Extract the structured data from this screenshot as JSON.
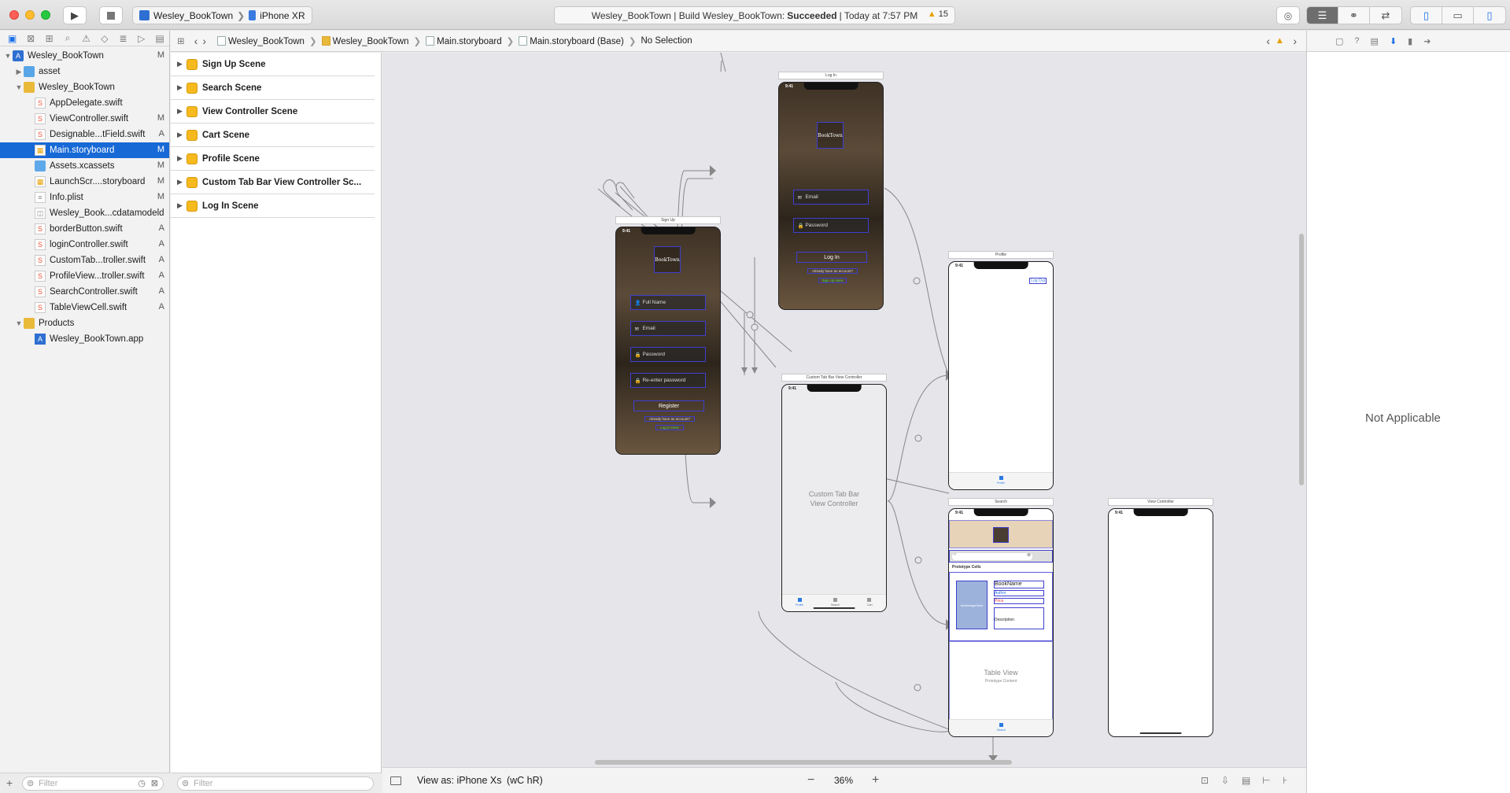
{
  "toolbar": {
    "scheme_target": "Wesley_BookTown",
    "scheme_device": "iPhone XR",
    "status_prefix": "Wesley_BookTown | Build Wesley_BookTown:",
    "status_result": "Succeeded",
    "status_time": "| Today at 7:57 PM",
    "warning_count": "15"
  },
  "navigator": {
    "items": [
      {
        "label": "Wesley_BookTown",
        "badge": "M"
      },
      {
        "label": "asset",
        "badge": ""
      },
      {
        "label": "Wesley_BookTown",
        "badge": ""
      },
      {
        "label": "AppDelegate.swift",
        "badge": ""
      },
      {
        "label": "ViewController.swift",
        "badge": "M"
      },
      {
        "label": "Designable...tField.swift",
        "badge": "A"
      },
      {
        "label": "Main.storyboard",
        "badge": "M"
      },
      {
        "label": "Assets.xcassets",
        "badge": "M"
      },
      {
        "label": "LaunchScr....storyboard",
        "badge": "M"
      },
      {
        "label": "Info.plist",
        "badge": "M"
      },
      {
        "label": "Wesley_Book...cdatamodeld",
        "badge": ""
      },
      {
        "label": "borderButton.swift",
        "badge": "A"
      },
      {
        "label": "loginController.swift",
        "badge": "A"
      },
      {
        "label": "CustomTab...troller.swift",
        "badge": "A"
      },
      {
        "label": "ProfileView...troller.swift",
        "badge": "A"
      },
      {
        "label": "SearchController.swift",
        "badge": "A"
      },
      {
        "label": "TableViewCell.swift",
        "badge": "A"
      },
      {
        "label": "Products",
        "badge": ""
      },
      {
        "label": "Wesley_BookTown.app",
        "badge": ""
      }
    ],
    "filter_placeholder": "Filter"
  },
  "jumpbar": {
    "crumbs": [
      "Wesley_BookTown",
      "Wesley_BookTown",
      "Main.storyboard",
      "Main.storyboard (Base)",
      "No Selection"
    ]
  },
  "outline": {
    "scenes": [
      "Sign Up Scene",
      "Search Scene",
      "View Controller Scene",
      "Cart Scene",
      "Profile Scene",
      "Custom Tab Bar View Controller Sc...",
      "Log In Scene"
    ],
    "filter_placeholder": "Filter"
  },
  "canvas": {
    "login": {
      "title": "Log In",
      "logo": "BookTown",
      "email": "Email",
      "password": "Password",
      "button": "Log In",
      "hint": "Already have an account?",
      "link": "Sign Up Here",
      "time": "9:41"
    },
    "signup": {
      "title": "Sign Up",
      "logo": "BookTown",
      "fullname": "Full Name",
      "email": "Email",
      "password": "Password",
      "reenter": "Re-enter password",
      "button": "Register",
      "hint": "Already have an account?",
      "link": "Log In Here",
      "time": "9:41"
    },
    "profile": {
      "title": "Profile",
      "logout": "Log Out",
      "tab": "Profile",
      "time": "9:41"
    },
    "tabbar_vc": {
      "title": "Custom Tab Bar View Controller",
      "label_line1": "Custom Tab Bar",
      "label_line2": "View Controller",
      "tabs": [
        "Profile",
        "Search",
        "Cart"
      ],
      "time": "9:41"
    },
    "search": {
      "title": "Search",
      "section": "Prototype Cells",
      "image": "bookImageView",
      "book_name": "BookName",
      "author": "Author",
      "price": "Price",
      "description": "Description",
      "table_view": "Table View",
      "table_sub": "Prototype Content",
      "tab": "Search",
      "time": "9:41"
    },
    "view_controller": {
      "title": "View Controller",
      "time": "9:41"
    }
  },
  "bottom_bar": {
    "view_as": "View as: iPhone Xs",
    "size_class": "(wC hR)",
    "zoom": "36%"
  },
  "inspector": {
    "empty_text": "Not Applicable"
  },
  "colors": {
    "selection": "#1769d6",
    "accent": "#1a6fe8",
    "warning": "#e6a000",
    "constraint": "#3f3fd0"
  }
}
